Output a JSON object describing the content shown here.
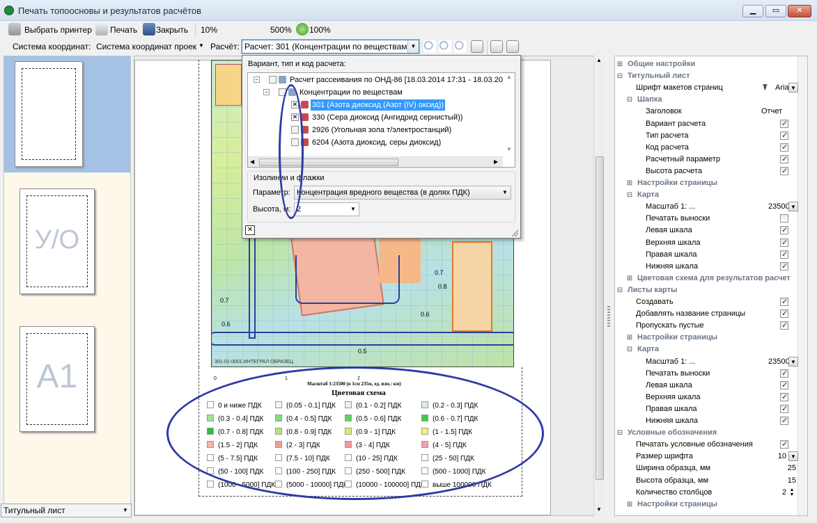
{
  "window": {
    "title": "Печать топоосновы и результатов расчётов"
  },
  "toolbar1": {
    "select_printer": "Выбрать принтер",
    "print": "Печать",
    "close": "Закрыть",
    "zoom_min": "10%",
    "zoom_max": "500%",
    "zoom_current": "100%"
  },
  "toolbar2": {
    "coord_label": "Система координат:",
    "coord_value": "Система координат проек",
    "calc_label": "Расчёт:",
    "calc_value": "Расчет: 301 (Концентрации по веществам)"
  },
  "left_panel": {
    "thumb_labels": [
      "",
      "У/О",
      "A1"
    ],
    "bottom_combo": "Титульный лист"
  },
  "popup": {
    "section_title": "Вариант, тип и код расчета:",
    "tree": [
      {
        "text": "Расчет рассеивания по ОНД-86 [18.03.2014 17:31 - 18.03.20",
        "level": 0,
        "checked": false
      },
      {
        "text": "Концентрации по веществам",
        "level": 1,
        "checked": false
      },
      {
        "text": "301 (Азота диоксид (Азот (IV) оксид))",
        "level": 2,
        "checked": true,
        "selected": true
      },
      {
        "text": "330 (Сера диоксид (Ангидрид сернистый))",
        "level": 2,
        "checked": true
      },
      {
        "text": "2926 (Угольная зола т/электростанций)",
        "level": 2,
        "checked": false
      },
      {
        "text": "6204 (Азота диоксид, серы диоксид)",
        "level": 2,
        "checked": false
      }
    ],
    "group_title": "Изолинии и флажки",
    "param_label": "Параметр:",
    "param_value": "Концентрация вредного вещества (в долях ПДК)",
    "height_label": "Высота, м:",
    "height_value": "2",
    "close_glyph": "✕"
  },
  "map": {
    "scale_text": "Масштаб 1:23500 (в 1см 235м, ед. изм.: км)",
    "legend_title": "Цветовая схема",
    "footer_text": "301-01-0001 ИНТЕГРАЛ ОБРАЗЕЦ",
    "contour_labels": [
      "0.7",
      "0.6",
      "0.5",
      "0.7",
      "0.6",
      "0.8"
    ],
    "axis_ticks": [
      "0",
      "1",
      "2"
    ],
    "legend": [
      {
        "label": "0 и ниже ПДК",
        "color": "#ffffff"
      },
      {
        "label": "(0.05 - 0.1] ПДК",
        "color": "#eef8f2"
      },
      {
        "label": "(0.1 - 0.2] ПДК",
        "color": "#e4f4ea"
      },
      {
        "label": "(0.2 - 0.3] ПДК",
        "color": "#d8f0df"
      },
      {
        "label": "(0.3 - 0.4] ПДК",
        "color": "#9be39b"
      },
      {
        "label": "(0.4 - 0.5] ПДК",
        "color": "#7fdc7f"
      },
      {
        "label": "(0.5 - 0.6] ПДК",
        "color": "#5fd35f"
      },
      {
        "label": "(0.6 - 0.7] ПДК",
        "color": "#3fcc4a"
      },
      {
        "label": "(0.7 - 0.8] ПДК",
        "color": "#22c23a"
      },
      {
        "label": "(0.8 - 0.9] ПДК",
        "color": "#b6e27a"
      },
      {
        "label": "(0.9 - 1] ПДК",
        "color": "#d9ee6a"
      },
      {
        "label": "(1 - 1.5] ПДК",
        "color": "#f3f36a"
      },
      {
        "label": "(1.5 - 2] ПДК",
        "color": "#f4b4a4"
      },
      {
        "label": "(2 - 3] ПДК",
        "color": "#f1a090"
      },
      {
        "label": "(3 - 4] ПДК",
        "color": "#ee9c9c"
      },
      {
        "label": "(4 - 5] ПДК",
        "color": "#f0a0b8"
      },
      {
        "label": "(5 - 7.5] ПДК",
        "color": "#ffffff"
      },
      {
        "label": "(7.5 - 10] ПДК",
        "color": "#ffffff"
      },
      {
        "label": "(10 - 25] ПДК",
        "color": "#ffffff"
      },
      {
        "label": "(25 - 50] ПДК",
        "color": "#ffffff"
      },
      {
        "label": "(50 - 100] ПДК",
        "color": "#ffffff"
      },
      {
        "label": "(100 - 250] ПДК",
        "color": "#ffffff"
      },
      {
        "label": "(250 - 500] ПДК",
        "color": "#ffffff"
      },
      {
        "label": "(500 - 1000] ПДК",
        "color": "#ffffff"
      },
      {
        "label": "(1000 - 5000] ПДК",
        "color": "#ffffff"
      },
      {
        "label": "(5000 - 10000] ПДК",
        "color": "#ffffff"
      },
      {
        "label": "(10000 - 100000] ПДК",
        "color": "#ffffff"
      },
      {
        "label": "выше 100000 ПДК",
        "color": "#ffffff"
      }
    ]
  },
  "properties": [
    {
      "type": "cat",
      "label": "Общие настройки",
      "level": 0,
      "exp": "⊞"
    },
    {
      "type": "cat",
      "label": "Титульный лист",
      "level": 0,
      "exp": "⊟"
    },
    {
      "type": "val",
      "label": "Шрифт макетов страниц",
      "level": 1,
      "value": "Arial",
      "kind": "font"
    },
    {
      "type": "cat",
      "label": "Шапка",
      "level": 1,
      "exp": "⊟"
    },
    {
      "type": "val",
      "label": "Заголовок",
      "level": 2,
      "value": "Отчет",
      "kind": "text"
    },
    {
      "type": "val",
      "label": "Вариант расчета",
      "level": 2,
      "checked": true,
      "kind": "check"
    },
    {
      "type": "val",
      "label": "Тип расчета",
      "level": 2,
      "checked": true,
      "kind": "check"
    },
    {
      "type": "val",
      "label": "Код расчета",
      "level": 2,
      "checked": true,
      "kind": "check"
    },
    {
      "type": "val",
      "label": "Расчетный параметр",
      "level": 2,
      "checked": true,
      "kind": "check"
    },
    {
      "type": "val",
      "label": "Высота расчета",
      "level": 2,
      "checked": true,
      "kind": "check"
    },
    {
      "type": "cat",
      "label": "Настройки страницы",
      "level": 1,
      "exp": "⊞"
    },
    {
      "type": "cat",
      "label": "Карта",
      "level": 1,
      "exp": "⊟"
    },
    {
      "type": "val",
      "label": "Масштаб 1: ...",
      "level": 2,
      "value": "23500",
      "kind": "combo"
    },
    {
      "type": "val",
      "label": "Печатать выноски",
      "level": 2,
      "checked": false,
      "kind": "check"
    },
    {
      "type": "val",
      "label": "Левая шкала",
      "level": 2,
      "checked": true,
      "kind": "check"
    },
    {
      "type": "val",
      "label": "Верхняя шкала",
      "level": 2,
      "checked": true,
      "kind": "check"
    },
    {
      "type": "val",
      "label": "Правая шкала",
      "level": 2,
      "checked": true,
      "kind": "check"
    },
    {
      "type": "val",
      "label": "Нижняя шкала",
      "level": 2,
      "checked": true,
      "kind": "check"
    },
    {
      "type": "cat",
      "label": "Цветовая схема для результатов расчет",
      "level": 1,
      "exp": "⊞"
    },
    {
      "type": "cat",
      "label": "Листы карты",
      "level": 0,
      "exp": "⊟"
    },
    {
      "type": "val",
      "label": "Создавать",
      "level": 1,
      "checked": true,
      "kind": "check"
    },
    {
      "type": "val",
      "label": "Добавлять название страницы",
      "level": 1,
      "checked": true,
      "kind": "check"
    },
    {
      "type": "val",
      "label": "Пропускать пустые",
      "level": 1,
      "checked": true,
      "kind": "check"
    },
    {
      "type": "cat",
      "label": "Настройки страницы",
      "level": 1,
      "exp": "⊞"
    },
    {
      "type": "cat",
      "label": "Карта",
      "level": 1,
      "exp": "⊟"
    },
    {
      "type": "val",
      "label": "Масштаб 1: ...",
      "level": 2,
      "value": "23500",
      "kind": "combo"
    },
    {
      "type": "val",
      "label": "Печатать выноски",
      "level": 2,
      "checked": true,
      "kind": "check"
    },
    {
      "type": "val",
      "label": "Левая шкала",
      "level": 2,
      "checked": true,
      "kind": "check"
    },
    {
      "type": "val",
      "label": "Верхняя шкала",
      "level": 2,
      "checked": true,
      "kind": "check"
    },
    {
      "type": "val",
      "label": "Правая шкала",
      "level": 2,
      "checked": true,
      "kind": "check"
    },
    {
      "type": "val",
      "label": "Нижняя шкала",
      "level": 2,
      "checked": true,
      "kind": "check"
    },
    {
      "type": "cat",
      "label": "Условные обозначения",
      "level": 0,
      "exp": "⊟"
    },
    {
      "type": "val",
      "label": "Печатать условные обозначения",
      "level": 1,
      "checked": true,
      "kind": "check"
    },
    {
      "type": "val",
      "label": "Размер шрифта",
      "level": 1,
      "value": "10",
      "kind": "combo"
    },
    {
      "type": "val",
      "label": "Ширина образца, мм",
      "level": 1,
      "value": "25",
      "kind": "num"
    },
    {
      "type": "val",
      "label": "Высота образца, мм",
      "level": 1,
      "value": "15",
      "kind": "num"
    },
    {
      "type": "val",
      "label": "Количество столбцов",
      "level": 1,
      "value": "2",
      "kind": "spin"
    },
    {
      "type": "cat",
      "label": "Настройки страницы",
      "level": 1,
      "exp": "⊞"
    }
  ]
}
